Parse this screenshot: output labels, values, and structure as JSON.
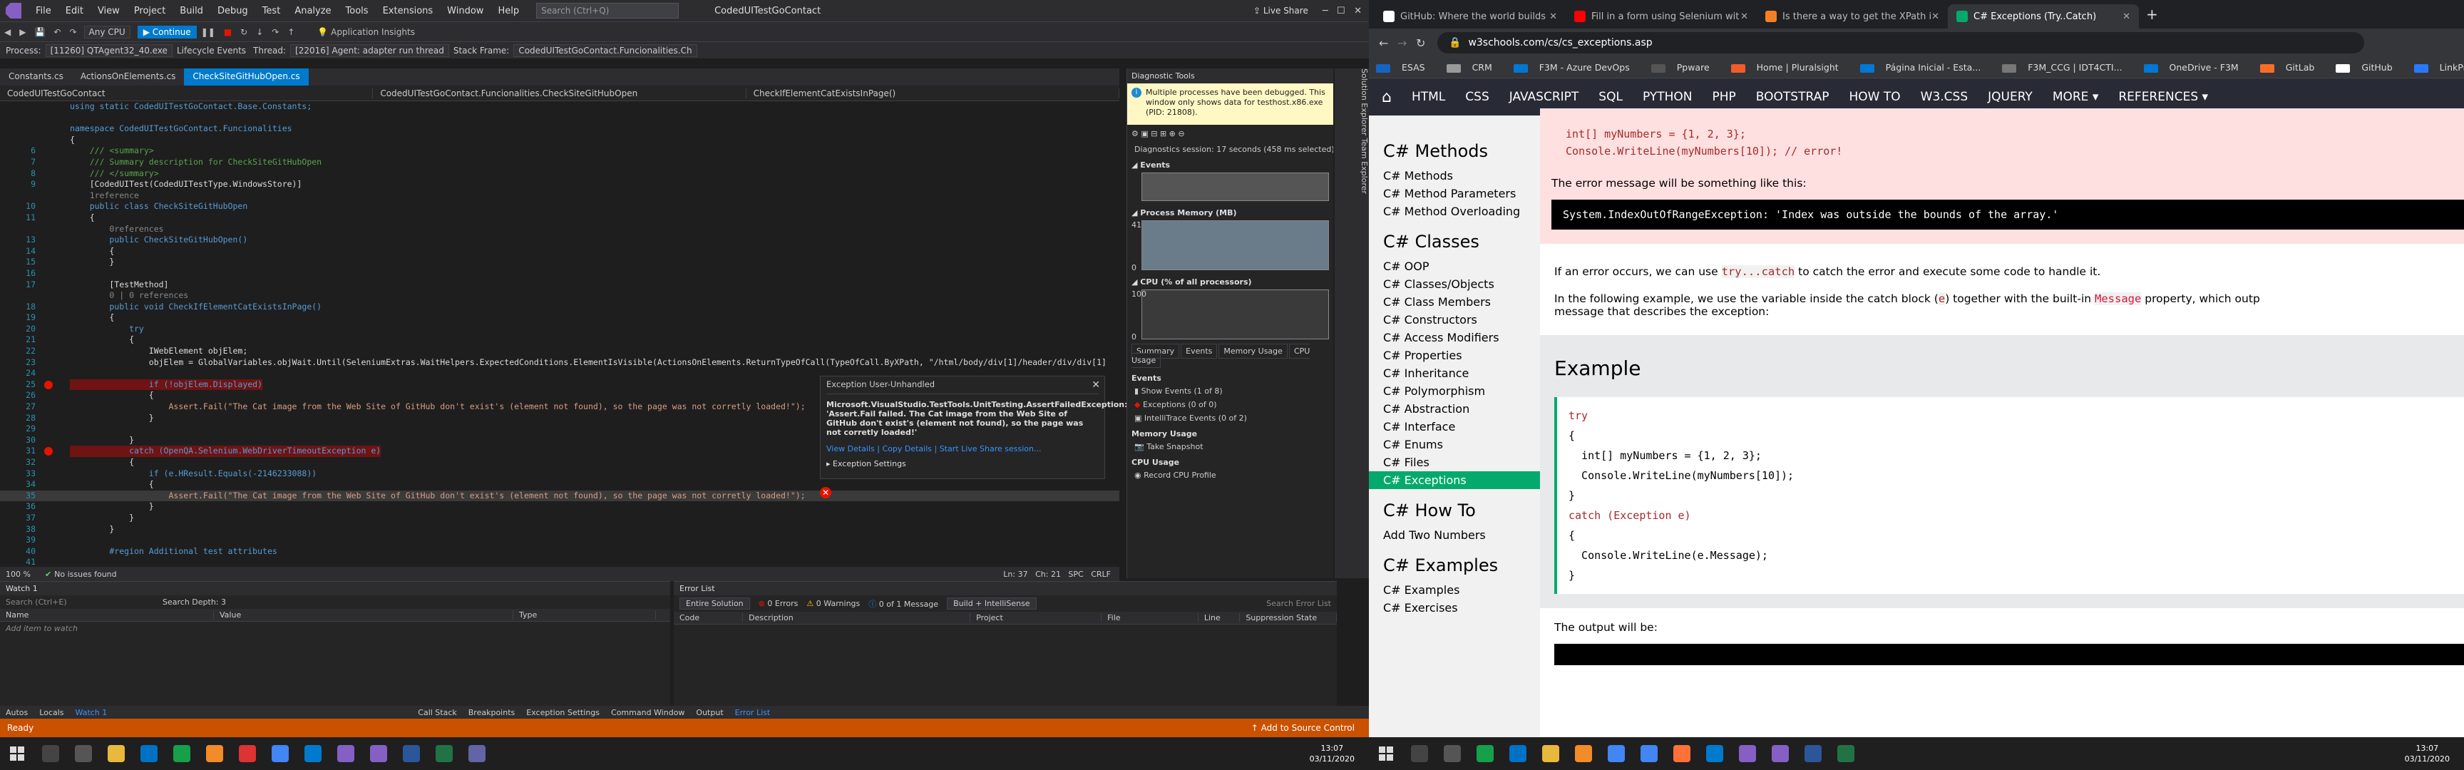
{
  "vs": {
    "title": {
      "menu": [
        "File",
        "Edit",
        "View",
        "Project",
        "Build",
        "Debug",
        "Test",
        "Analyze",
        "Tools",
        "Extensions",
        "Window",
        "Help"
      ],
      "search_placeholder": "Search (Ctrl+Q)",
      "solution": "CodedUITestGoContact",
      "live_share": "Live Share"
    },
    "toolbar": {
      "any_cpu": "Any CPU",
      "continue": "Continue",
      "app_insights": "Application Insights"
    },
    "debugbar": {
      "process_label": "Process:",
      "process": "[11260] QTAgent32_40.exe",
      "lifecycle": "Lifecycle Events",
      "thread_label": "Thread:",
      "thread": "[22016] Agent: adapter run thread",
      "stack_label": "Stack Frame:",
      "stack": "CodedUITestGoContact.Funcionalities.Ch"
    },
    "doc_tabs": [
      "Constants.cs",
      "ActionsOnElements.cs",
      "CheckSiteGitHubOpen.cs"
    ],
    "nav": [
      "CodedUITestGoContact",
      "CodedUITestGoContact.Funcionalities.CheckSiteGitHubOpen",
      "CheckIfElementCatExistsInPage()"
    ],
    "code_lines": [
      {
        "n": "",
        "t": "using static CodedUITestGoContact.Base.Constants;"
      },
      {
        "n": "",
        "t": ""
      },
      {
        "n": "",
        "t": "namespace CodedUITestGoContact.Funcionalities"
      },
      {
        "n": "",
        "t": "{"
      },
      {
        "n": "6",
        "t": "    /// <summary>"
      },
      {
        "n": "7",
        "t": "    /// Summary description for CheckSiteGitHubOpen"
      },
      {
        "n": "8",
        "t": "    /// </summary>"
      },
      {
        "n": "9",
        "t": "    [CodedUITest(CodedUITestType.WindowsStore)]"
      },
      {
        "n": "",
        "t": "    1reference"
      },
      {
        "n": "10",
        "t": "    public class CheckSiteGitHubOpen"
      },
      {
        "n": "11",
        "t": "    {"
      },
      {
        "n": "",
        "t": "        0references"
      },
      {
        "n": "13",
        "t": "        public CheckSiteGitHubOpen()"
      },
      {
        "n": "14",
        "t": "        {"
      },
      {
        "n": "15",
        "t": "        }"
      },
      {
        "n": "16",
        "t": ""
      },
      {
        "n": "17",
        "t": "        [TestMethod]"
      },
      {
        "n": "",
        "t": "        0 | 0 references"
      },
      {
        "n": "18",
        "t": "        public void CheckIfElementCatExistsInPage()"
      },
      {
        "n": "19",
        "t": "        {"
      },
      {
        "n": "20",
        "t": "            try"
      },
      {
        "n": "21",
        "t": "            {"
      },
      {
        "n": "22",
        "t": "                IWebElement objElem;"
      },
      {
        "n": "23",
        "t": "                objElem = GlobalVariables.objWait.Until(SeleniumExtras.WaitHelpers.ExpectedConditions.ElementIsVisible(ActionsOnElements.ReturnTypeOfCall(TypeOfCall.ByXPath, \"/html/body/div[1]/header/div/div[1]"
      },
      {
        "n": "24",
        "t": ""
      },
      {
        "n": "25",
        "t": "                if (!objElem.Displayed)"
      },
      {
        "n": "26",
        "t": "                {"
      },
      {
        "n": "27",
        "t": "                    Assert.Fail(\"The Cat image from the Web Site of GitHub don't exist's (element not found), so the page was not corretly loaded!\");"
      },
      {
        "n": "28",
        "t": "                }"
      },
      {
        "n": "29",
        "t": ""
      },
      {
        "n": "30",
        "t": "            }"
      },
      {
        "n": "31",
        "t": "            catch (OpenQA.Selenium.WebDriverTimeoutException e)"
      },
      {
        "n": "32",
        "t": "            {"
      },
      {
        "n": "33",
        "t": "                if (e.HResult.Equals(-2146233088))"
      },
      {
        "n": "34",
        "t": "                {"
      },
      {
        "n": "35",
        "t": "                    Assert.Fail(\"The Cat image from the Web Site of GitHub don't exist's (element not found), so the page was not corretly loaded!\");"
      },
      {
        "n": "36",
        "t": "                }"
      },
      {
        "n": "37",
        "t": "            }"
      },
      {
        "n": "38",
        "t": "        }"
      },
      {
        "n": "39",
        "t": ""
      },
      {
        "n": "40",
        "t": "        #region Additional test attributes"
      },
      {
        "n": "41",
        "t": ""
      },
      {
        "n": "42",
        "t": ""
      }
    ],
    "exception": {
      "title": "Exception User-Unhandled",
      "message": "Microsoft.VisualStudio.TestTools.UnitTesting.AssertFailedException: 'Assert.Fail failed. The Cat image from the Web Site of GitHub don't exist's (element not found), so the page was not corretly loaded!'",
      "link1": "View Details",
      "link2": "Copy Details",
      "link3": "Start Live Share session...",
      "settings": "Exception Settings"
    },
    "editor_status": {
      "zoom": "100 %",
      "issues": "No issues found",
      "pos": "Ln: 37   Ch: 21   SPC   CRLF"
    },
    "diag": {
      "title": "Diagnostic Tools",
      "warn": "Multiple processes have been debugged. This window only shows data for testhost.x86.exe (PID: 21808).",
      "session": "Diagnostics session: 17 seconds (458 ms selected)",
      "events": "Events",
      "memory": "Process Memory (MB)",
      "mem_max": "41",
      "mem_min": "0",
      "cpu": "CPU (% of all processors)",
      "cpu_max": "100",
      "cpu_min": "0",
      "tabs": [
        "Summary",
        "Events",
        "Memory Usage",
        "CPU Usage"
      ],
      "ev_head": "Events",
      "ev_rows": [
        "Show Events (1 of 8)",
        "Exceptions (0 of 0)",
        "IntelliTrace Events (0 of 2)"
      ],
      "mem_head": "Memory Usage",
      "mem_row": "Take Snapshot",
      "cpu_head": "CPU Usage",
      "cpu_row": "Record CPU Profile",
      "strip": "Solution Explorer   Team Explorer"
    },
    "watch": {
      "title": "Watch 1",
      "search": "Search (Ctrl+E)",
      "depth": "Search Depth: 3",
      "cols": [
        "Name",
        "Value",
        "Type"
      ],
      "add": "Add item to watch"
    },
    "errlist": {
      "title": "Error List",
      "scope": "Entire Solution",
      "errors": "0 Errors",
      "warnings": "0 Warnings",
      "messages": "0 of 1 Message",
      "build": "Build + IntelliSense",
      "search": "Search Error List",
      "cols": [
        "Code",
        "Description",
        "Project",
        "File",
        "Line",
        "Suppression State"
      ]
    },
    "bottom_tabs_left": [
      "Autos",
      "Locals",
      "Watch 1"
    ],
    "bottom_tabs_right": [
      "Call Stack",
      "Breakpoints",
      "Exception Settings",
      "Command Window",
      "Output",
      "Error List"
    ],
    "status": {
      "ready": "Ready",
      "source": "Add to Source Control"
    }
  },
  "chrome": {
    "tabs": [
      {
        "label": "GitHub: Where the world builds",
        "color": "#ffffff"
      },
      {
        "label": "Fill in a form using Selenium wit",
        "color": "#ff0000"
      },
      {
        "label": "Is there a way to get the XPath in",
        "color": "#f48024"
      },
      {
        "label": "C# Exceptions (Try..Catch)",
        "color": "#04aa6d"
      }
    ],
    "url": "w3schools.com/cs/cs_exceptions.asp",
    "bookmarks": [
      {
        "label": "ESAS",
        "color": "#1565c0"
      },
      {
        "label": "CRM",
        "color": "#999999"
      },
      {
        "label": "F3M - Azure DevOps",
        "color": "#0078d4"
      },
      {
        "label": "Ppware",
        "color": "#555555"
      },
      {
        "label": "Home | Pluralsight",
        "color": "#f15b2a"
      },
      {
        "label": "Página Inicial - Esta...",
        "color": "#0078d4"
      },
      {
        "label": "F3M_CCG | IDT4CTI...",
        "color": "#777777"
      },
      {
        "label": "OneDrive - F3M",
        "color": "#0078d4"
      },
      {
        "label": "GitLab",
        "color": "#fc6d26"
      },
      {
        "label": "GitHub",
        "color": "#ffffff"
      },
      {
        "label": "LinkPreview API",
        "color": "#2979ff"
      }
    ],
    "w3nav": [
      "HTML",
      "CSS",
      "JAVASCRIPT",
      "SQL",
      "PYTHON",
      "PHP",
      "BOOTSTRAP",
      "HOW TO",
      "W3.CSS",
      "JQUERY",
      "MORE ▾",
      "REFERENCES ▾"
    ],
    "side": [
      {
        "h": "C# Methods",
        "items": [
          "C# Methods",
          "C# Method Parameters",
          "C# Method Overloading"
        ]
      },
      {
        "h": "C# Classes",
        "items": [
          "C# OOP",
          "C# Classes/Objects",
          "C# Class Members",
          "C# Constructors",
          "C# Access Modifiers",
          "C# Properties",
          "C# Inheritance",
          "C# Polymorphism",
          "C# Abstraction",
          "C# Interface",
          "C# Enums",
          "C# Files",
          "C# Exceptions"
        ]
      },
      {
        "h": "C# How To",
        "items": [
          "Add Two Numbers"
        ]
      },
      {
        "h": "C# Examples",
        "items": [
          "C# Examples",
          "C# Exercises"
        ]
      }
    ],
    "main": {
      "err_line1_a": "int[] myNumbers = {1, 2, 3};",
      "err_line2_a": "Console.WriteLine(myNumbers[10]); // error!",
      "err_msg": "The error message will be something like this:",
      "exception_text": "System.IndexOutOfRangeException: 'Index was outside the bounds of the array.'",
      "p1_a": "If an error occurs, we can use ",
      "p1_code": "try...catch",
      "p1_b": " to catch the error and execute some code to handle it.",
      "p2_a": "In the following example, we use the variable inside the catch block (",
      "p2_code": "e",
      "p2_b": ") together with the built-in ",
      "p2_code2": "Message",
      "p2_c": " property, which outp",
      "p2_d": "message that describes the exception:",
      "example_title": "Example",
      "code": [
        "try",
        "{",
        "  int[] myNumbers = {1, 2, 3};",
        "  Console.WriteLine(myNumbers[10]);",
        "}",
        "catch (Exception e)",
        "{",
        "  Console.WriteLine(e.Message);",
        "}"
      ],
      "output_label": "The output will be:"
    }
  },
  "taskbar": {
    "time": "13:07",
    "date": "03/11/2020"
  }
}
